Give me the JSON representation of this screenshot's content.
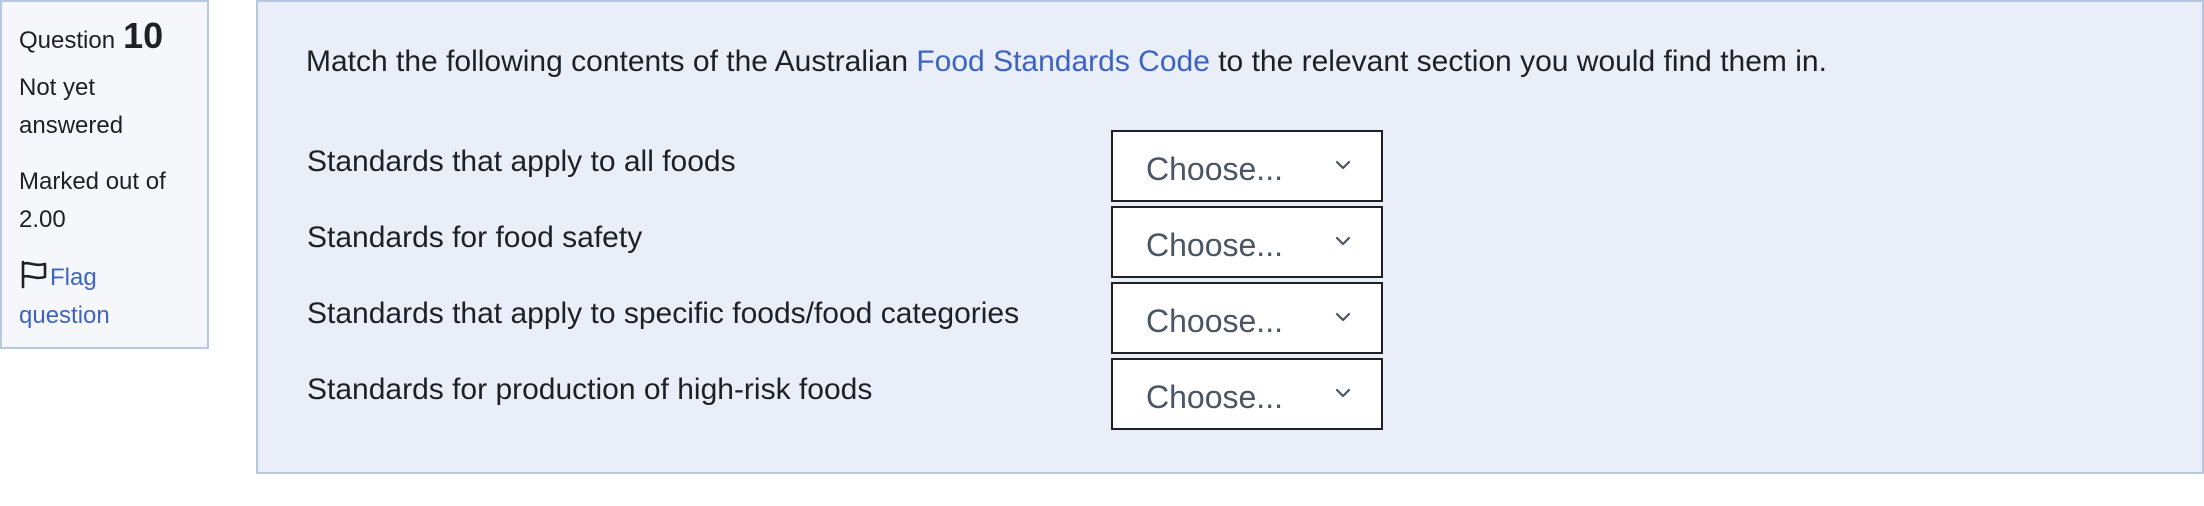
{
  "info": {
    "question_label": "Question",
    "question_number": "10",
    "state_line1": "Not yet",
    "state_line2": "answered",
    "grade_line1": "Marked out of",
    "grade_line2": "2.00",
    "flag_line1": "Flag",
    "flag_line2": "question",
    "flag_icon": "flag-outline-icon"
  },
  "question": {
    "prompt_before": "Match the following contents of the Australian ",
    "prompt_link": "Food Standards Code",
    "prompt_after": " to the relevant section you would find them in.",
    "rows": [
      {
        "label": "Standards that apply to all foods",
        "selected": "Choose..."
      },
      {
        "label": "Standards for food safety",
        "selected": "Choose..."
      },
      {
        "label": "Standards that apply to specific foods/food categories",
        "selected": "Choose..."
      },
      {
        "label": "Standards for production of high-risk foods",
        "selected": "Choose..."
      }
    ]
  },
  "colors": {
    "link": "#3d64c2",
    "panel_bg": "#e9eef8",
    "info_bg": "#f5f7fa",
    "border": "#b7c7e0"
  }
}
